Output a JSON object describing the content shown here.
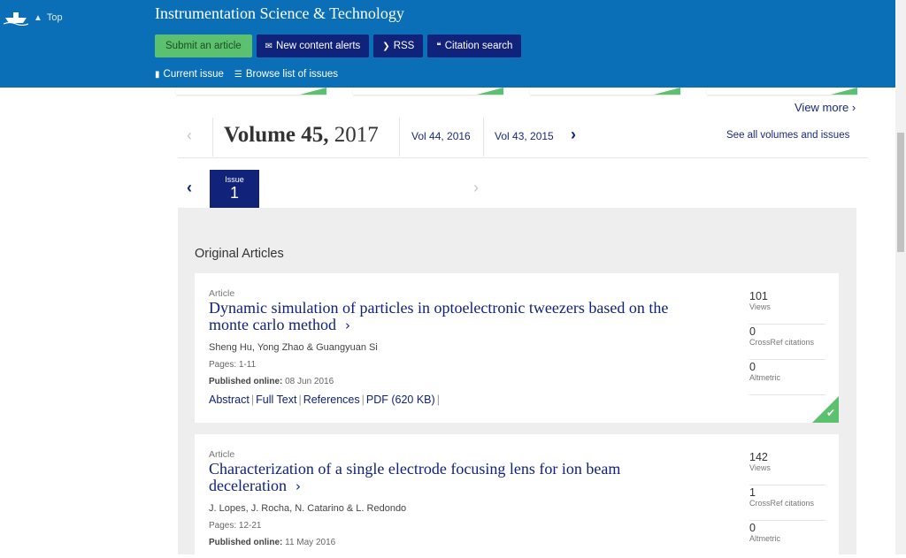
{
  "header": {
    "top_label": "Top",
    "journal_title": "Instrumentation Science & Technology",
    "buttons": {
      "submit": "Submit an article",
      "alerts": "New content alerts",
      "rss": "RSS",
      "citation": "Citation search"
    },
    "subnav": {
      "current_issue": "Current issue",
      "browse": "Browse list of issues"
    }
  },
  "view_more": "View more",
  "volumes": {
    "current_label": "Volume 45,",
    "current_year": "2017",
    "other": [
      "Vol 44, 2016",
      "Vol 43, 2015"
    ],
    "see_all": "See all volumes and issues"
  },
  "issue": {
    "label": "Issue",
    "number": "1"
  },
  "section_title": "Original Articles",
  "articles": [
    {
      "type": "Article",
      "title": "Dynamic simulation of particles in optoelectronic tweezers based on the monte carlo method",
      "authors": "Sheng Hu, Yong Zhao & Guangyuan Si",
      "pages": "Pages: 1-11",
      "published_label": "Published online:",
      "published_date": "08 Jun 2016",
      "links": [
        "Abstract",
        "Full Text",
        "References",
        "PDF (620 KB)"
      ],
      "metrics": [
        {
          "value": "101",
          "label": "Views"
        },
        {
          "value": "0",
          "label": "CrossRef citations"
        },
        {
          "value": "0",
          "label": "Altmetric"
        }
      ]
    },
    {
      "type": "Article",
      "title": "Characterization of a single electrode focusing lens for ion beam deceleration",
      "authors": "J. Lopes, J. Rocha, N. Catarino & L. Redondo",
      "pages": "Pages: 12-21",
      "published_label": "Published online:",
      "published_date": "11 May 2016",
      "metrics": [
        {
          "value": "142",
          "label": "Views"
        },
        {
          "value": "1",
          "label": "CrossRef citations"
        },
        {
          "value": "0",
          "label": "Altmetric"
        }
      ]
    }
  ],
  "colors": {
    "header_bg": "#0a6fb7",
    "navy": "#10227a",
    "green": "#5cc16e",
    "content_bg": "#eeeeee"
  },
  "icons": [
    "ship-logo-icon",
    "chevron-up-icon",
    "envelope-icon",
    "rss-icon",
    "quote-icon",
    "book-icon",
    "list-icon",
    "chevron-left-icon",
    "chevron-right-icon",
    "check-icon"
  ]
}
